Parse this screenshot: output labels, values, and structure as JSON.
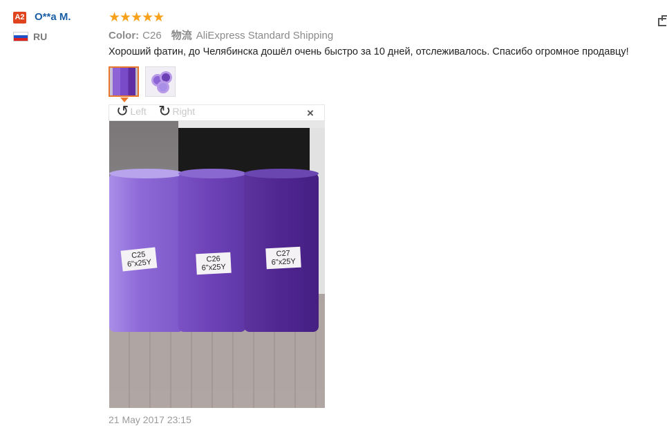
{
  "reviewer": {
    "badge": "A2",
    "name": "O**a M.",
    "country": "RU"
  },
  "rating": {
    "stars_text": "★★★★★",
    "value": 5,
    "max": 5
  },
  "meta": {
    "color_label": "Color:",
    "color_value": "C26",
    "shipping_label": "物流",
    "shipping_value": "AliExpress Standard Shipping"
  },
  "review_text": "Хороший фатин, до Челябинска дошёл очень быстро за 10 дней, отслеживалось. Спасибо огромное продавцу!",
  "viewer": {
    "rotate_left": "Left",
    "rotate_right": "Right",
    "close": "×"
  },
  "photo_labels": [
    {
      "code": "C25",
      "size": "6\"x25Y"
    },
    {
      "code": "C26",
      "size": "6\"x25Y"
    },
    {
      "code": "C27",
      "size": "6\"x25Y"
    }
  ],
  "date": "21 May 2017 23:15",
  "colors": {
    "accent": "#e8792c",
    "stars": "#f7a11a",
    "name": "#1a5fa6"
  }
}
